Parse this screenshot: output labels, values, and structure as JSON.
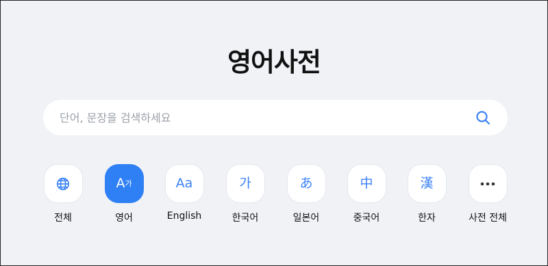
{
  "page": {
    "title": "영어사전"
  },
  "search": {
    "placeholder": "단어, 문장을 검색하세요",
    "value": ""
  },
  "colors": {
    "accent": "#2f80f5",
    "icon": "#3b82f6",
    "background": "#f0f2f6"
  },
  "categories": [
    {
      "label": "전체",
      "icon": "globe-icon",
      "glyph": "",
      "active": false
    },
    {
      "label": "영어",
      "icon": "english-korean-icon",
      "glyph": "A",
      "glyph_sub": "가",
      "active": true
    },
    {
      "label": "English",
      "icon": "aa-icon",
      "glyph": "Aa",
      "active": false
    },
    {
      "label": "한국어",
      "icon": "hangul-icon",
      "glyph": "가",
      "active": false
    },
    {
      "label": "일본어",
      "icon": "hiragana-icon",
      "glyph": "あ",
      "active": false
    },
    {
      "label": "중국어",
      "icon": "hanzi-icon",
      "glyph": "中",
      "active": false
    },
    {
      "label": "한자",
      "icon": "hanja-icon",
      "glyph": "漢",
      "active": false
    },
    {
      "label": "사전 전체",
      "icon": "more-icon",
      "glyph": "",
      "active": false
    }
  ]
}
